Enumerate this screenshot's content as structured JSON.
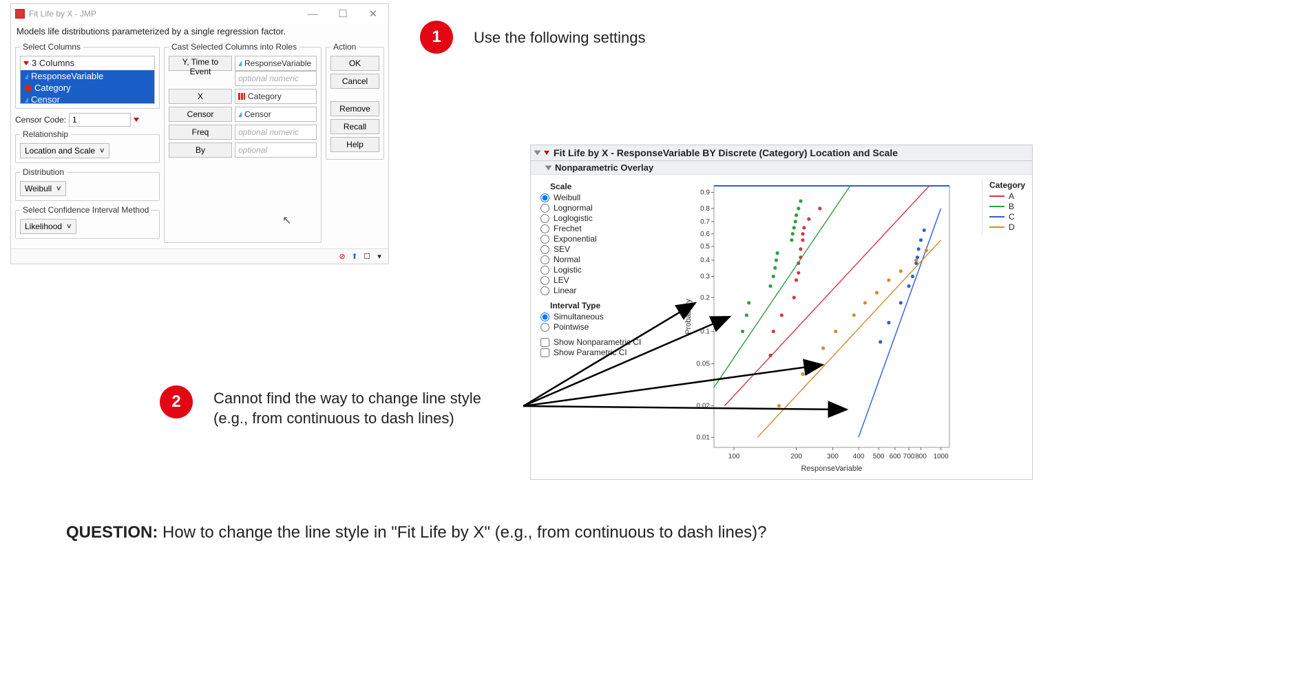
{
  "dialog": {
    "title": "Fit Life by X - JMP",
    "description": "Models life distributions parameterized by a single regression factor.",
    "select_columns_legend": "Select Columns",
    "columns_header": "3 Columns",
    "columns": [
      "ResponseVariable",
      "Category",
      "Censor"
    ],
    "censor_code_label": "Censor Code:",
    "censor_code_value": "1",
    "relationship_legend": "Relationship",
    "relationship_value": "Location and Scale",
    "distribution_legend": "Distribution",
    "distribution_value": "Weibull",
    "ci_legend": "Select Confidence Interval Method",
    "ci_value": "Likelihood",
    "cast_legend": "Cast Selected Columns into Roles",
    "roles": {
      "y_btn": "Y, Time to Event",
      "y_val": "ResponseVariable",
      "y_ph": "optional numeric",
      "x_btn": "X",
      "x_val": "Category",
      "censor_btn": "Censor",
      "censor_val": "Censor",
      "freq_btn": "Freq",
      "freq_ph": "optional numeric",
      "by_btn": "By",
      "by_ph": "optional"
    },
    "action_legend": "Action",
    "actions": {
      "ok": "OK",
      "cancel": "Cancel",
      "remove": "Remove",
      "recall": "Recall",
      "help": "Help"
    }
  },
  "callouts": {
    "n1": "1",
    "t1": "Use the following settings",
    "n2": "2",
    "t2a": "Cannot find the way to change line style",
    "t2b": "(e.g., from continuous to dash lines)",
    "question_b": "QUESTION:",
    "question": " How to change the line style in \"Fit Life by X\" (e.g., from continuous to dash lines)?"
  },
  "output": {
    "title": "Fit Life by X - ResponseVariable BY Discrete (Category) Location and Scale",
    "subtitle": "Nonparametric Overlay",
    "scale_header": "Scale",
    "scales": [
      "Weibull",
      "Lognormal",
      "Loglogistic",
      "Frechet",
      "Exponential",
      "SEV",
      "Normal",
      "Logistic",
      "LEV",
      "Linear"
    ],
    "scale_selected": "Weibull",
    "interval_header": "Interval Type",
    "intervals": [
      "Simultaneous",
      "Pointwise"
    ],
    "interval_selected": "Simultaneous",
    "check1": "Show Nonparametric CI",
    "check2": "Show Parametric CI",
    "legend_header": "Category",
    "legend": [
      {
        "label": "A",
        "color": "#d4364a"
      },
      {
        "label": "B",
        "color": "#2e9e3f"
      },
      {
        "label": "C",
        "color": "#2a5fd8"
      },
      {
        "label": "D",
        "color": "#d68a2d"
      }
    ],
    "xlabel": "ResponseVariable",
    "ylabel": "Probability"
  },
  "chart_data": {
    "type": "scatter+line",
    "title": "Nonparametric Overlay",
    "xlabel": "ResponseVariable",
    "ylabel": "Probability",
    "x_scale": "log",
    "y_scale": "weibull",
    "x_ticks": [
      100,
      200,
      300,
      400,
      500,
      600,
      700,
      800,
      1000
    ],
    "y_ticks": [
      0.01,
      0.02,
      0.05,
      0.1,
      0.2,
      0.3,
      0.4,
      0.5,
      0.6,
      0.7,
      0.8,
      0.9
    ],
    "series": [
      {
        "name": "A",
        "color": "#d4364a",
        "points": [
          [
            150,
            0.06
          ],
          [
            155,
            0.1
          ],
          [
            170,
            0.14
          ],
          [
            195,
            0.2
          ],
          [
            200,
            0.28
          ],
          [
            205,
            0.32
          ],
          [
            205,
            0.38
          ],
          [
            210,
            0.42
          ],
          [
            210,
            0.48
          ],
          [
            215,
            0.55
          ],
          [
            215,
            0.6
          ],
          [
            218,
            0.65
          ],
          [
            230,
            0.72
          ],
          [
            260,
            0.8
          ]
        ],
        "line": [
          [
            90,
            0.02
          ],
          [
            1000,
            0.97
          ]
        ]
      },
      {
        "name": "B",
        "color": "#2e9e3f",
        "points": [
          [
            110,
            0.1
          ],
          [
            115,
            0.14
          ],
          [
            118,
            0.18
          ],
          [
            150,
            0.25
          ],
          [
            155,
            0.3
          ],
          [
            158,
            0.35
          ],
          [
            160,
            0.4
          ],
          [
            162,
            0.45
          ],
          [
            190,
            0.55
          ],
          [
            192,
            0.6
          ],
          [
            195,
            0.65
          ],
          [
            198,
            0.7
          ],
          [
            200,
            0.75
          ],
          [
            205,
            0.8
          ],
          [
            210,
            0.85
          ]
        ],
        "line": [
          [
            80,
            0.03
          ],
          [
            400,
            0.97
          ]
        ]
      },
      {
        "name": "C",
        "color": "#2a5fd8",
        "points": [
          [
            510,
            0.08
          ],
          [
            560,
            0.12
          ],
          [
            640,
            0.18
          ],
          [
            700,
            0.25
          ],
          [
            730,
            0.3
          ],
          [
            760,
            0.38
          ],
          [
            770,
            0.42
          ],
          [
            780,
            0.48
          ],
          [
            800,
            0.55
          ],
          [
            830,
            0.63
          ]
        ],
        "line": [
          [
            400,
            0.01
          ],
          [
            1000,
            0.8
          ]
        ]
      },
      {
        "name": "D",
        "color": "#d68a2d",
        "points": [
          [
            165,
            0.02
          ],
          [
            215,
            0.04
          ],
          [
            270,
            0.07
          ],
          [
            310,
            0.1
          ],
          [
            380,
            0.14
          ],
          [
            430,
            0.18
          ],
          [
            490,
            0.22
          ],
          [
            560,
            0.28
          ],
          [
            640,
            0.33
          ],
          [
            760,
            0.4
          ],
          [
            850,
            0.47
          ]
        ],
        "line": [
          [
            130,
            0.01
          ],
          [
            1000,
            0.55
          ]
        ]
      }
    ]
  }
}
